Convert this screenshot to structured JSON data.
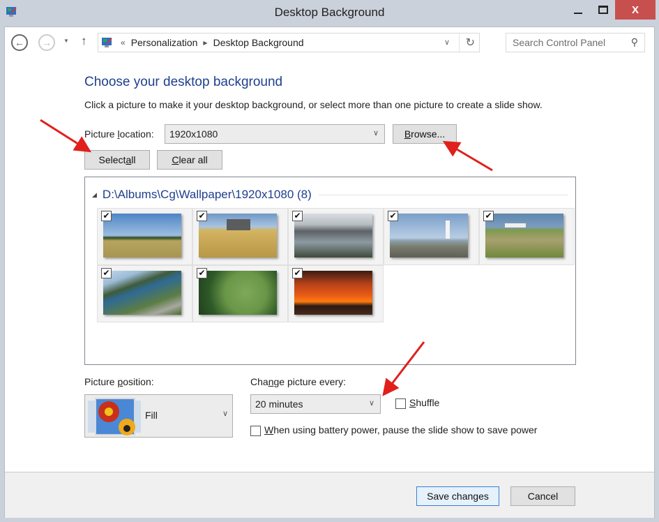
{
  "window": {
    "title": "Desktop Background",
    "icon": "control-panel-icon",
    "controls": {
      "minimize": "minimize",
      "maximize": "maximize",
      "close": "X"
    }
  },
  "navbar": {
    "back_icon": "back-arrow-icon",
    "forward_icon": "forward-arrow-icon",
    "up_icon": "up-arrow-icon",
    "breadcrumb_prefix": "«",
    "breadcrumb": [
      "Personalization",
      "Desktop Background"
    ],
    "search_placeholder": "Search Control Panel"
  },
  "main": {
    "heading": "Choose your desktop background",
    "description": "Click a picture to make it your desktop background, or select more than one picture to create a slide show.",
    "picture_location": {
      "label_pre": "Picture ",
      "label_accel": "l",
      "label_post": "ocation:",
      "value": "1920x1080"
    },
    "buttons": {
      "browse_accel": "B",
      "browse_rest": "rowse...",
      "select_all_pre": "Select ",
      "select_all_accel": "a",
      "select_all_post": "ll",
      "clear_all_accel": "C",
      "clear_all_rest": "lear all"
    },
    "gallery": {
      "group_title": "D:\\Albums\\Cg\\Wallpaper\\1920x1080 (8)",
      "pictures": [
        {
          "subject": "field with houses under blue sky",
          "checked": true
        },
        {
          "subject": "barn in wheat field",
          "checked": true
        },
        {
          "subject": "rocky tidal pools",
          "checked": true
        },
        {
          "subject": "lighthouse on rocks",
          "checked": true
        },
        {
          "subject": "boat on grassy shore",
          "checked": true
        },
        {
          "subject": "coastal road by sea",
          "checked": true
        },
        {
          "subject": "aerial view of farmland",
          "checked": true
        },
        {
          "subject": "sunset over bridge",
          "checked": true
        }
      ]
    }
  },
  "position": {
    "label_pre": "Picture ",
    "label_accel": "p",
    "label_post": "osition:",
    "value": "Fill"
  },
  "slideshow": {
    "label_pre": "Cha",
    "label_accel": "n",
    "label_post": "ge picture every:",
    "interval": "20 minutes",
    "shuffle_accel": "S",
    "shuffle_rest": "huffle",
    "shuffle_checked": false,
    "battery_accel": "W",
    "battery_rest": "hen using battery power, pause the slide show to save power",
    "battery_checked": false
  },
  "footer": {
    "save": "Save changes",
    "cancel": "Cancel"
  },
  "annotations": {
    "arrow_color": "#e0201c",
    "arrows": [
      "points-to-select-all",
      "points-to-browse",
      "points-to-interval-dropdown"
    ]
  }
}
